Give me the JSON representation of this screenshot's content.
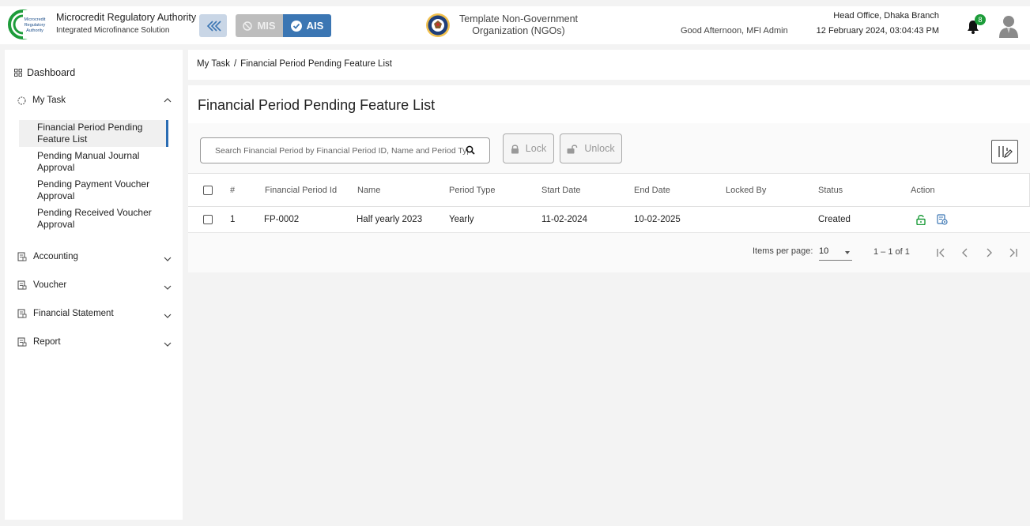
{
  "header": {
    "org_title": "Microcredit Regulatory Authority",
    "org_subtitle": "Integrated Microfinance Solution",
    "logo_text": [
      "Microcredit",
      "Regulatory",
      "Authority"
    ],
    "mis_label": "MIS",
    "ais_label": "AIS",
    "ngo_name": "Template Non-Government Organization (NGOs)",
    "greeting": "Good Afternoon, MFI Admin",
    "branch": "Head Office, Dhaka Branch",
    "datetime": "12 February 2024, 03:04:43 PM",
    "notification_count": "8",
    "accent_color": "#3b76b3"
  },
  "sidebar": {
    "dashboard_label": "Dashboard",
    "my_task_label": "My Task",
    "sub_items": [
      {
        "label": "Financial Period Pending Feature List",
        "active": true
      },
      {
        "label": "Pending Manual Journal Approval",
        "active": false
      },
      {
        "label": "Pending Payment Voucher Approval",
        "active": false
      },
      {
        "label": "Pending Received Voucher Approval",
        "active": false
      }
    ],
    "sections": [
      {
        "label": "Accounting"
      },
      {
        "label": "Voucher"
      },
      {
        "label": "Financial Statement"
      },
      {
        "label": "Report"
      }
    ]
  },
  "breadcrumb": {
    "parent": "My Task",
    "separator": "/",
    "current": "Financial Period Pending Feature List"
  },
  "main": {
    "title": "Financial Period Pending Feature List",
    "search_placeholder": "Search Financial Period by Financial Period ID, Name and Period Type",
    "lock_label": "Lock",
    "unlock_label": "Unlock",
    "columns": [
      "#",
      "Financial Period Id",
      "Name",
      "Period Type",
      "Start Date",
      "End Date",
      "Locked By",
      "Status",
      "Action"
    ],
    "rows": [
      {
        "index": "1",
        "financial_period_id": "FP-0002",
        "name": "Half yearly 2023",
        "period_type": "Yearly",
        "start_date": "11-02-2024",
        "end_date": "10-02-2025",
        "locked_by": "",
        "status": "Created",
        "actions": [
          "unlock-icon",
          "view-details-icon"
        ]
      }
    ],
    "paginator": {
      "items_per_page_label": "Items per page:",
      "items_per_page": "10",
      "range_label": "1 – 1 of 1"
    }
  }
}
